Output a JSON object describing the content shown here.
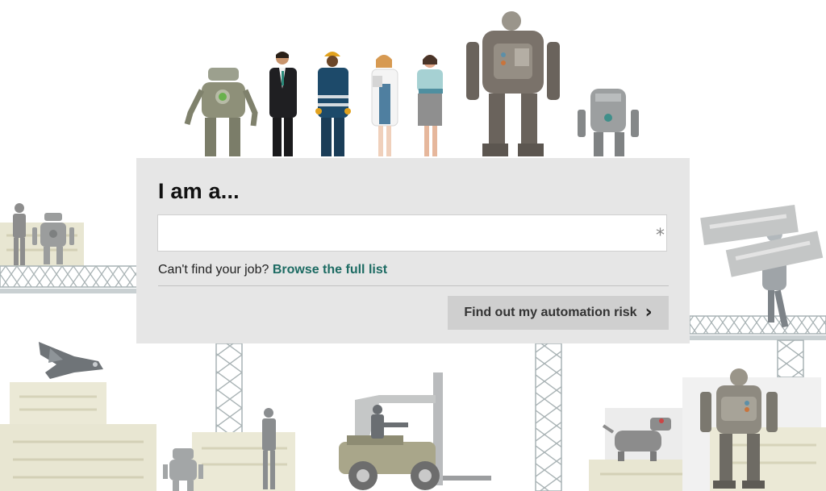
{
  "form": {
    "title": "I am a...",
    "input_value": "",
    "input_placeholder": "",
    "required_mark": "*",
    "help_prefix": "Can't find your job? ",
    "browse_link": "Browse the full list",
    "submit_label": "Find out my automation risk",
    "submit_icon": "chevron-right-icon"
  },
  "colors": {
    "card_bg": "#e6e6e6",
    "button_bg": "#cfcfcf",
    "link": "#1d6b63",
    "robot_dark": "#7a726a",
    "robot_green": "#8e9079",
    "robot_gray": "#9c9fa0",
    "scaffold": "#b7c0c2",
    "crate": "#e8e6d2"
  }
}
